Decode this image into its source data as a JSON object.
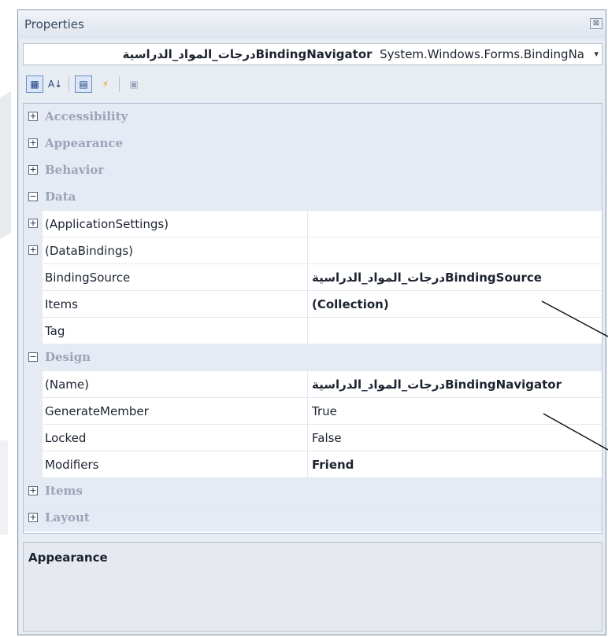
{
  "window": {
    "title": "Properties",
    "close_label": "⊠"
  },
  "object_selector": {
    "name": "درجات_المواد_الدراسيةBindingNavigator",
    "type": "System.Windows.Forms.BindingNa"
  },
  "toolbar": {
    "buttons": [
      {
        "icon": "categorized-icon",
        "active": true
      },
      {
        "icon": "alphabetical-icon",
        "active": false
      },
      {
        "icon": "properties-icon",
        "active": true
      },
      {
        "icon": "events-icon",
        "active": false
      },
      {
        "icon": "property-pages-icon",
        "active": false
      }
    ]
  },
  "grid": {
    "rows": [
      {
        "kind": "category",
        "label": "Accessibility",
        "expanded": false
      },
      {
        "kind": "category",
        "label": "Appearance",
        "expanded": false
      },
      {
        "kind": "category",
        "label": "Behavior",
        "expanded": false
      },
      {
        "kind": "category",
        "label": "Data",
        "expanded": true
      },
      {
        "kind": "property",
        "name": "(ApplicationSettings)",
        "value": "",
        "expandable": true,
        "bold": false
      },
      {
        "kind": "property",
        "name": "(DataBindings)",
        "value": "",
        "expandable": true,
        "bold": false
      },
      {
        "kind": "property",
        "name": "BindingSource",
        "value": "درجات_المواد_الدراسيةBindingSource",
        "expandable": false,
        "bold": true
      },
      {
        "kind": "property",
        "name": "Items",
        "value": "(Collection)",
        "expandable": false,
        "bold": true
      },
      {
        "kind": "property",
        "name": "Tag",
        "value": "",
        "expandable": false,
        "bold": false
      },
      {
        "kind": "category",
        "label": "Design",
        "expanded": true
      },
      {
        "kind": "property",
        "name": "(Name)",
        "value": "درجات_المواد_الدراسيةBindingNavigator",
        "expandable": false,
        "bold": true
      },
      {
        "kind": "property",
        "name": "GenerateMember",
        "value": "True",
        "expandable": false,
        "bold": false
      },
      {
        "kind": "property",
        "name": "Locked",
        "value": "False",
        "expandable": false,
        "bold": false
      },
      {
        "kind": "property",
        "name": "Modifiers",
        "value": "Friend",
        "expandable": false,
        "bold": true
      },
      {
        "kind": "category",
        "label": "Items",
        "expanded": false
      },
      {
        "kind": "category",
        "label": "Layout",
        "expanded": false
      }
    ]
  },
  "description": {
    "title": "Appearance"
  }
}
